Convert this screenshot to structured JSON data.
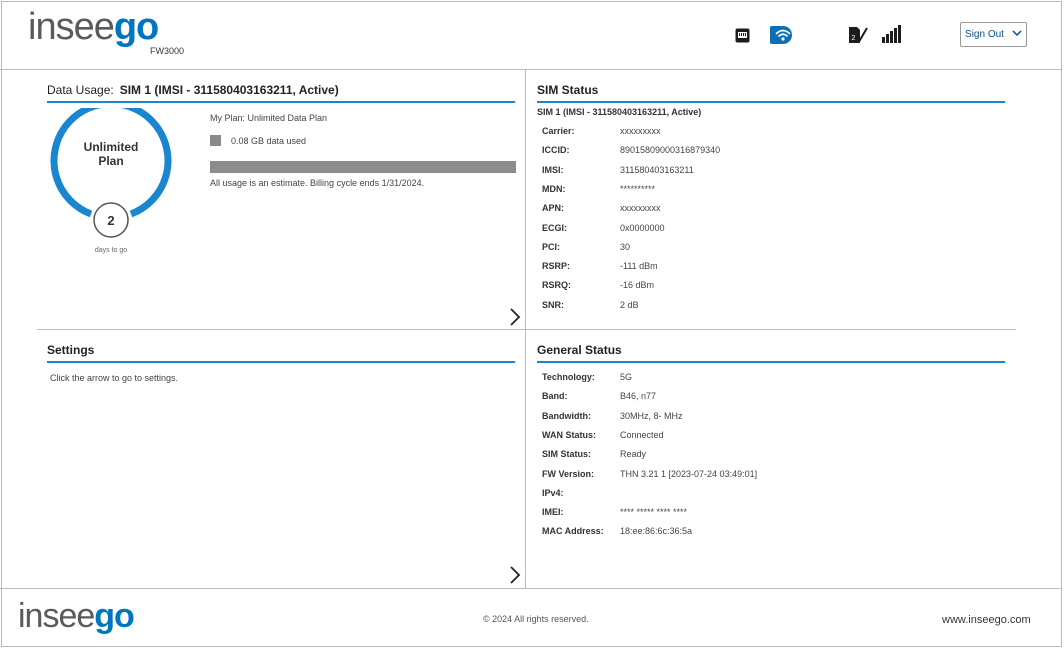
{
  "header": {
    "logo_left": "insee",
    "logo_right": "go",
    "model": "FW3000",
    "icons": [
      "ethernet-icon",
      "wifi-icon",
      "sim-check-icon",
      "signal-bars-icon"
    ],
    "sign_out_label": "Sign Out"
  },
  "data_usage": {
    "title_label": "Data Usage:",
    "title_value": "SIM 1 (IMSI - 311580403163211, Active)",
    "ring_line1": "Unlimited",
    "ring_line2": "Plan",
    "days_remaining": "2",
    "days_label": "days to go",
    "plan": "My Plan: Unlimited Data Plan",
    "used": "0.08 GB data used",
    "usage_fraction": 1.0,
    "note": "All usage is an estimate. Billing cycle ends 1/31/2024."
  },
  "sim_status": {
    "title": "SIM Status",
    "subtitle": "SIM 1 (IMSI - 311580403163211, Active)",
    "rows": [
      {
        "label": "Carrier:",
        "value": "xxxxxxxxx"
      },
      {
        "label": "ICCID:",
        "value": "89015809000316879340"
      },
      {
        "label": "IMSI:",
        "value": "311580403163211"
      },
      {
        "label": "MDN:",
        "value": "**********"
      },
      {
        "label": "APN:",
        "value": "xxxxxxxxx"
      },
      {
        "label": "ECGI:",
        "value": "0x0000000"
      },
      {
        "label": "PCI:",
        "value": "30"
      },
      {
        "label": "RSRP:",
        "value": "-111 dBm"
      },
      {
        "label": "RSRQ:",
        "value": "-16 dBm"
      },
      {
        "label": "SNR:",
        "value": "2 dB"
      }
    ]
  },
  "settings": {
    "title": "Settings",
    "text": "Click the arrow to go to settings."
  },
  "general_status": {
    "title": "General Status",
    "rows": [
      {
        "label": "Technology:",
        "value": "5G"
      },
      {
        "label": "Band:",
        "value": "B46, n77"
      },
      {
        "label": "Bandwidth:",
        "value": "30MHz, 8- MHz"
      },
      {
        "label": "WAN Status:",
        "value": "Connected"
      },
      {
        "label": "SIM Status:",
        "value": "Ready"
      },
      {
        "label": "FW Version:",
        "value": "THN 3.21 1 [2023-07-24 03:49:01]"
      },
      {
        "label": "IPv4:",
        "value": ""
      },
      {
        "label": "IMEI:",
        "value": "**** ***** **** ****"
      },
      {
        "label": "MAC Address:",
        "value": "18:ee:86:6c:36:5a"
      }
    ]
  },
  "footer": {
    "logo_left": "insee",
    "logo_right": "go",
    "copyright": "© 2024 All rights reserved.",
    "website": "www.inseego.com"
  },
  "colors": {
    "accent": "#0076c0",
    "ring": "#1a86d0",
    "usage_bar": "#8c8c8c"
  }
}
